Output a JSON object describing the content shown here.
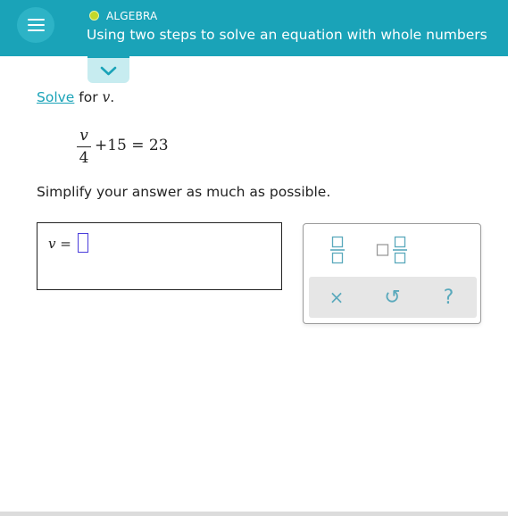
{
  "header": {
    "topic": "ALGEBRA",
    "title": "Using two steps to solve an equation with whole numbers",
    "accent_color": "#1aa3b8",
    "topic_dot_color": "#c3d82a",
    "menu_icon": "hamburger-menu-icon",
    "collapse_icon": "chevron-down-icon"
  },
  "question": {
    "prompt_link": "Solve",
    "prompt_text": "for",
    "variable": "v",
    "period": ".",
    "equation": {
      "numerator": "v",
      "denominator": "4",
      "rest": "+15 = 23"
    },
    "instruction": "Simplify your answer as much as possible."
  },
  "answer": {
    "label": "v =",
    "value": ""
  },
  "keypad": {
    "buttons": [
      {
        "name": "fraction",
        "icon": "fraction-template-icon"
      },
      {
        "name": "mixed-number",
        "icon": "mixed-number-template-icon"
      },
      {
        "name": "clear",
        "icon": "x-icon",
        "glyph": "×"
      },
      {
        "name": "undo",
        "icon": "undo-icon",
        "glyph": "↺"
      },
      {
        "name": "help",
        "icon": "question-icon",
        "glyph": "?"
      }
    ]
  }
}
